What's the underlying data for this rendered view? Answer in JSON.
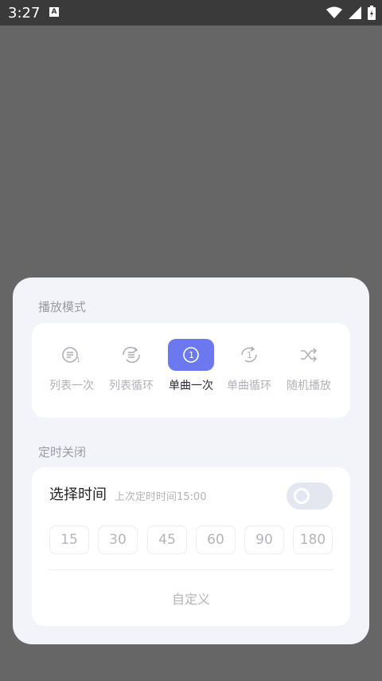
{
  "status_bar": {
    "time": "3:27",
    "notification_letter": "A"
  },
  "play_mode": {
    "title": "播放模式",
    "active_index": 2,
    "modes": [
      {
        "label": "列表一次",
        "icon": "list-once-icon"
      },
      {
        "label": "列表循环",
        "icon": "list-repeat-icon"
      },
      {
        "label": "单曲一次",
        "icon": "single-once-icon"
      },
      {
        "label": "单曲循环",
        "icon": "single-repeat-icon"
      },
      {
        "label": "随机播放",
        "icon": "shuffle-icon"
      }
    ]
  },
  "timer": {
    "title": "定时关闭",
    "select_label": "选择时间",
    "last_timer": "上次定时时间15:00",
    "toggle_on": false,
    "options": [
      "15",
      "30",
      "45",
      "60",
      "90",
      "180"
    ],
    "custom_label": "自定义"
  },
  "colors": {
    "accent": "#6b78f0",
    "sheet": "#f3f4f9",
    "overlay": "#666666"
  }
}
